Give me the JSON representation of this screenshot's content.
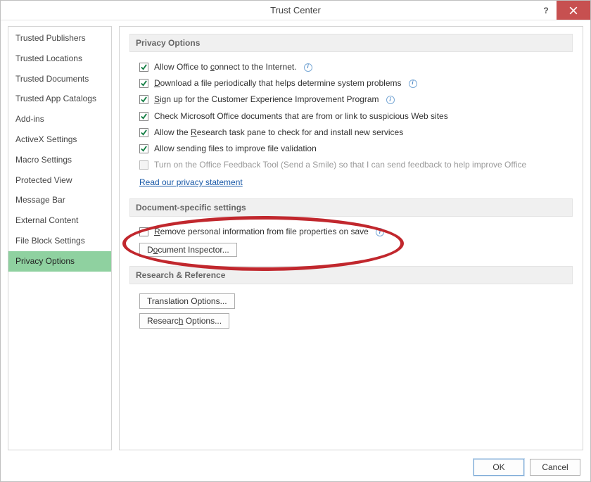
{
  "title": "Trust Center",
  "help_symbol": "?",
  "sidebar": {
    "items": [
      {
        "label": "Trusted Publishers"
      },
      {
        "label": "Trusted Locations"
      },
      {
        "label": "Trusted Documents"
      },
      {
        "label": "Trusted App Catalogs"
      },
      {
        "label": "Add-ins"
      },
      {
        "label": "ActiveX Settings"
      },
      {
        "label": "Macro Settings"
      },
      {
        "label": "Protected View"
      },
      {
        "label": "Message Bar"
      },
      {
        "label": "External Content"
      },
      {
        "label": "File Block Settings"
      },
      {
        "label": "Privacy Options"
      }
    ],
    "active_index": 11
  },
  "sections": {
    "privacy": {
      "header": "Privacy Options",
      "opts": [
        {
          "pre": "Allow Office to ",
          "u": "c",
          "post": "onnect to the Internet.",
          "checked": true,
          "info": true,
          "disabled": false
        },
        {
          "pre": "",
          "u": "D",
          "post": "ownload a file periodically that helps determine system problems",
          "checked": true,
          "info": true,
          "disabled": false
        },
        {
          "pre": "",
          "u": "S",
          "post": "ign up for the Customer Experience Improvement Program",
          "checked": true,
          "info": true,
          "disabled": false
        },
        {
          "pre": "Check Microsoft Office documents that are from or link to suspicious Web sites",
          "u": "",
          "post": "",
          "checked": true,
          "info": false,
          "disabled": false
        },
        {
          "pre": "Allow the ",
          "u": "R",
          "post": "esearch task pane to check for and install new services",
          "checked": true,
          "info": false,
          "disabled": false
        },
        {
          "pre": "Allow sending files to improve file validation",
          "u": "",
          "post": "",
          "checked": true,
          "info": false,
          "disabled": false
        },
        {
          "pre": "Turn on the Office Feedback Tool (Send a Smile) so that I can send feedback to help improve Office",
          "u": "",
          "post": "",
          "checked": false,
          "info": false,
          "disabled": true
        }
      ],
      "privacy_link": "Read our privacy statement"
    },
    "doc_specific": {
      "header": "Document-specific settings",
      "remove_pre": "",
      "remove_u": "R",
      "remove_post": "emove personal information from file properties on save",
      "remove_checked": false,
      "inspector_btn": "Document Inspector..."
    },
    "research": {
      "header": "Research & Reference",
      "translation_btn": "Translation Options...",
      "research_btn": "Research Options..."
    }
  },
  "footer": {
    "ok": "OK",
    "cancel": "Cancel"
  }
}
